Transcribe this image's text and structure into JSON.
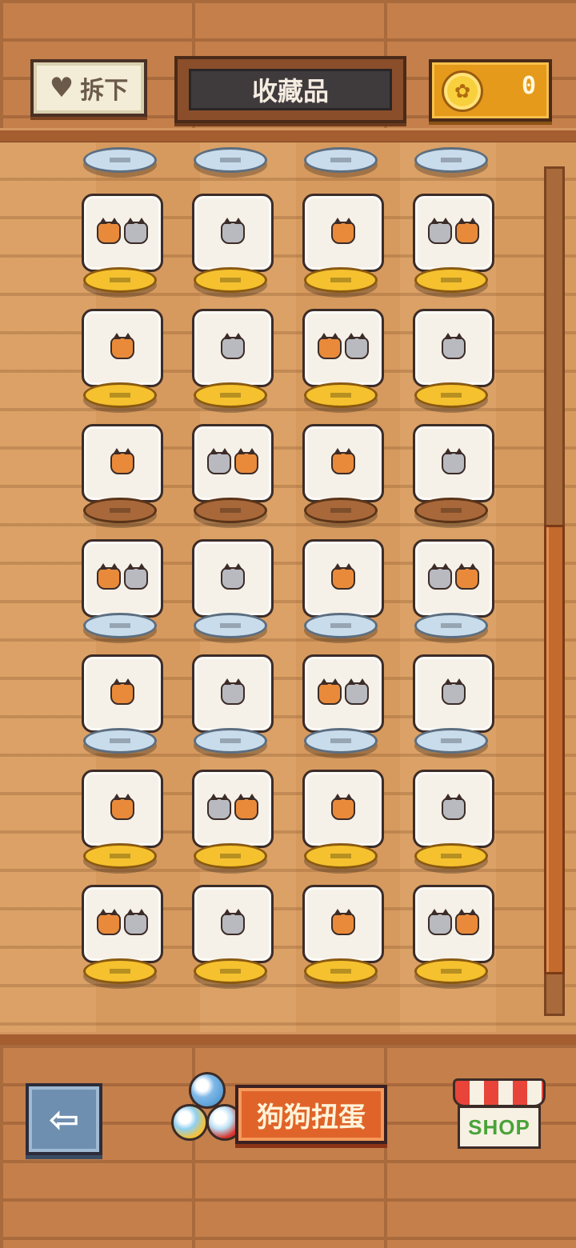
{
  "header": {
    "unequip_label": "拆下",
    "title": "收藏品",
    "coin_count": "0"
  },
  "icons": {
    "heart": "heart-icon",
    "coin": "paw-coin-icon",
    "back": "left-arrow-icon",
    "gacha": "gacha-capsules-icon",
    "shop": "shop-awning-icon"
  },
  "footer": {
    "gacha_label": "狗狗扭蛋",
    "shop_label": "SHOP"
  },
  "collection": {
    "items": [
      {
        "id": "bathtub",
        "stand": "gold"
      },
      {
        "id": "mirror-pups",
        "stand": "gold"
      },
      {
        "id": "dinner-table",
        "stand": "gold"
      },
      {
        "id": "arched-door",
        "stand": "gold"
      },
      {
        "id": "tea-cart",
        "stand": "gold"
      },
      {
        "id": "snow-globe-red",
        "stand": "gold"
      },
      {
        "id": "cookie-bed",
        "stand": "gold"
      },
      {
        "id": "pile-of-pups",
        "stand": "gold"
      },
      {
        "id": "gray-pup-scarf",
        "stand": "bronze"
      },
      {
        "id": "floor-lamp",
        "stand": "bronze"
      },
      {
        "id": "wardrobe",
        "stand": "bronze"
      },
      {
        "id": "plant-chair",
        "stand": "bronze"
      },
      {
        "id": "window-pups",
        "stand": "silver"
      },
      {
        "id": "sleeping-pair",
        "stand": "silver"
      },
      {
        "id": "sofa-pups",
        "stand": "silver"
      },
      {
        "id": "round-window",
        "stand": "silver"
      },
      {
        "id": "arched-door-2",
        "stand": "silver"
      },
      {
        "id": "armchair",
        "stand": "silver"
      },
      {
        "id": "computer-desk",
        "stand": "silver"
      },
      {
        "id": "blue-cushion",
        "stand": "silver"
      },
      {
        "id": "fireplace",
        "stand": "gold"
      },
      {
        "id": "table-pair",
        "stand": "gold"
      },
      {
        "id": "snow-globe-blue",
        "stand": "gold"
      },
      {
        "id": "bathtub-2",
        "stand": "gold"
      },
      {
        "id": "wizard-pup",
        "stand": "gold"
      },
      {
        "id": "moon-pup",
        "stand": "gold"
      },
      {
        "id": "parachute-orange",
        "stand": "gold"
      },
      {
        "id": "parachute-gray",
        "stand": "gold"
      }
    ]
  }
}
